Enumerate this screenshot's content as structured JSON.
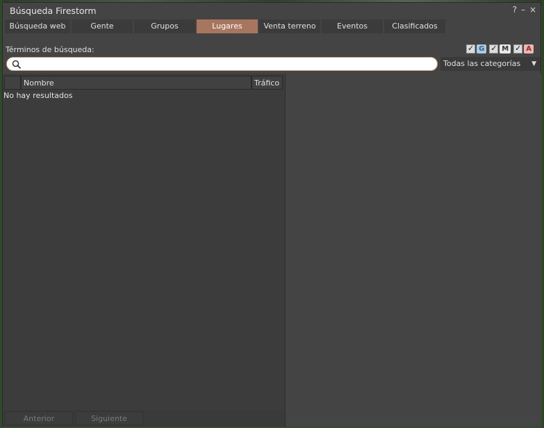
{
  "window": {
    "title": "Búsqueda Firestorm",
    "help": "?",
    "minimize": "–",
    "close": "×"
  },
  "tabs": [
    {
      "label": "Búsqueda web"
    },
    {
      "label": "Gente"
    },
    {
      "label": "Grupos"
    },
    {
      "label": "Lugares",
      "active": true
    },
    {
      "label": "Venta terreno"
    },
    {
      "label": "Eventos"
    },
    {
      "label": "Clasificados"
    }
  ],
  "search": {
    "terms_label": "Términos de búsqueda:",
    "value": "",
    "placeholder": ""
  },
  "maturity": {
    "general": "G",
    "moderate": "M",
    "adult": "A",
    "check": "✓"
  },
  "category": {
    "selected": "Todas las categorías"
  },
  "results": {
    "columns": {
      "name": "Nombre",
      "traffic": "Tráfico"
    },
    "empty_message": "No hay resultados"
  },
  "pager": {
    "prev": "Anterior",
    "next": "Siguiente"
  },
  "colors": {
    "active_tab": "#a8765e",
    "panel": "#444444",
    "rating_g": "#a9cbe8",
    "rating_m": "#e8e8e8",
    "rating_a": "#efb4b4"
  }
}
